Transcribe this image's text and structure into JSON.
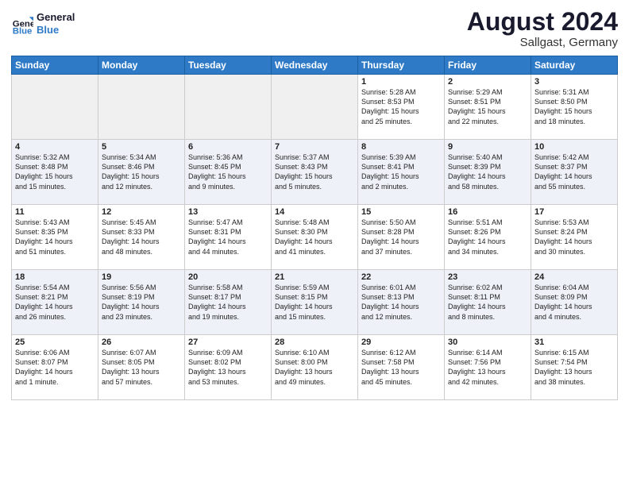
{
  "header": {
    "logo_general": "General",
    "logo_blue": "Blue",
    "month_year": "August 2024",
    "location": "Sallgast, Germany"
  },
  "days_of_week": [
    "Sunday",
    "Monday",
    "Tuesday",
    "Wednesday",
    "Thursday",
    "Friday",
    "Saturday"
  ],
  "weeks": [
    [
      {
        "day": "",
        "empty": true
      },
      {
        "day": "",
        "empty": true
      },
      {
        "day": "",
        "empty": true
      },
      {
        "day": "",
        "empty": true
      },
      {
        "day": "1",
        "info": "Sunrise: 5:28 AM\nSunset: 8:53 PM\nDaylight: 15 hours\nand 25 minutes."
      },
      {
        "day": "2",
        "info": "Sunrise: 5:29 AM\nSunset: 8:51 PM\nDaylight: 15 hours\nand 22 minutes."
      },
      {
        "day": "3",
        "info": "Sunrise: 5:31 AM\nSunset: 8:50 PM\nDaylight: 15 hours\nand 18 minutes."
      }
    ],
    [
      {
        "day": "4",
        "info": "Sunrise: 5:32 AM\nSunset: 8:48 PM\nDaylight: 15 hours\nand 15 minutes."
      },
      {
        "day": "5",
        "info": "Sunrise: 5:34 AM\nSunset: 8:46 PM\nDaylight: 15 hours\nand 12 minutes."
      },
      {
        "day": "6",
        "info": "Sunrise: 5:36 AM\nSunset: 8:45 PM\nDaylight: 15 hours\nand 9 minutes."
      },
      {
        "day": "7",
        "info": "Sunrise: 5:37 AM\nSunset: 8:43 PM\nDaylight: 15 hours\nand 5 minutes."
      },
      {
        "day": "8",
        "info": "Sunrise: 5:39 AM\nSunset: 8:41 PM\nDaylight: 15 hours\nand 2 minutes."
      },
      {
        "day": "9",
        "info": "Sunrise: 5:40 AM\nSunset: 8:39 PM\nDaylight: 14 hours\nand 58 minutes."
      },
      {
        "day": "10",
        "info": "Sunrise: 5:42 AM\nSunset: 8:37 PM\nDaylight: 14 hours\nand 55 minutes."
      }
    ],
    [
      {
        "day": "11",
        "info": "Sunrise: 5:43 AM\nSunset: 8:35 PM\nDaylight: 14 hours\nand 51 minutes."
      },
      {
        "day": "12",
        "info": "Sunrise: 5:45 AM\nSunset: 8:33 PM\nDaylight: 14 hours\nand 48 minutes."
      },
      {
        "day": "13",
        "info": "Sunrise: 5:47 AM\nSunset: 8:31 PM\nDaylight: 14 hours\nand 44 minutes."
      },
      {
        "day": "14",
        "info": "Sunrise: 5:48 AM\nSunset: 8:30 PM\nDaylight: 14 hours\nand 41 minutes."
      },
      {
        "day": "15",
        "info": "Sunrise: 5:50 AM\nSunset: 8:28 PM\nDaylight: 14 hours\nand 37 minutes."
      },
      {
        "day": "16",
        "info": "Sunrise: 5:51 AM\nSunset: 8:26 PM\nDaylight: 14 hours\nand 34 minutes."
      },
      {
        "day": "17",
        "info": "Sunrise: 5:53 AM\nSunset: 8:24 PM\nDaylight: 14 hours\nand 30 minutes."
      }
    ],
    [
      {
        "day": "18",
        "info": "Sunrise: 5:54 AM\nSunset: 8:21 PM\nDaylight: 14 hours\nand 26 minutes."
      },
      {
        "day": "19",
        "info": "Sunrise: 5:56 AM\nSunset: 8:19 PM\nDaylight: 14 hours\nand 23 minutes."
      },
      {
        "day": "20",
        "info": "Sunrise: 5:58 AM\nSunset: 8:17 PM\nDaylight: 14 hours\nand 19 minutes."
      },
      {
        "day": "21",
        "info": "Sunrise: 5:59 AM\nSunset: 8:15 PM\nDaylight: 14 hours\nand 15 minutes."
      },
      {
        "day": "22",
        "info": "Sunrise: 6:01 AM\nSunset: 8:13 PM\nDaylight: 14 hours\nand 12 minutes."
      },
      {
        "day": "23",
        "info": "Sunrise: 6:02 AM\nSunset: 8:11 PM\nDaylight: 14 hours\nand 8 minutes."
      },
      {
        "day": "24",
        "info": "Sunrise: 6:04 AM\nSunset: 8:09 PM\nDaylight: 14 hours\nand 4 minutes."
      }
    ],
    [
      {
        "day": "25",
        "info": "Sunrise: 6:06 AM\nSunset: 8:07 PM\nDaylight: 14 hours\nand 1 minute."
      },
      {
        "day": "26",
        "info": "Sunrise: 6:07 AM\nSunset: 8:05 PM\nDaylight: 13 hours\nand 57 minutes."
      },
      {
        "day": "27",
        "info": "Sunrise: 6:09 AM\nSunset: 8:02 PM\nDaylight: 13 hours\nand 53 minutes."
      },
      {
        "day": "28",
        "info": "Sunrise: 6:10 AM\nSunset: 8:00 PM\nDaylight: 13 hours\nand 49 minutes."
      },
      {
        "day": "29",
        "info": "Sunrise: 6:12 AM\nSunset: 7:58 PM\nDaylight: 13 hours\nand 45 minutes."
      },
      {
        "day": "30",
        "info": "Sunrise: 6:14 AM\nSunset: 7:56 PM\nDaylight: 13 hours\nand 42 minutes."
      },
      {
        "day": "31",
        "info": "Sunrise: 6:15 AM\nSunset: 7:54 PM\nDaylight: 13 hours\nand 38 minutes."
      }
    ]
  ]
}
